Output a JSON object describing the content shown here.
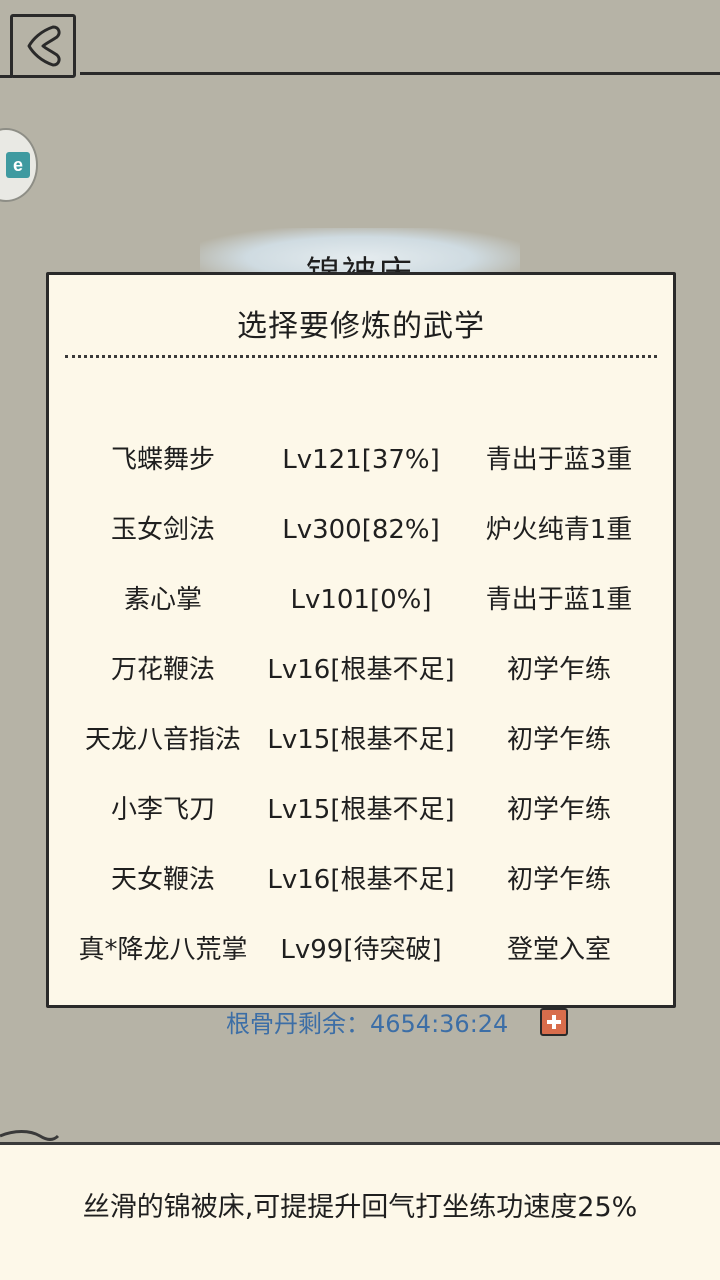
{
  "header": {
    "back_icon": "back-arrow-icon"
  },
  "side_button": {
    "glyph": "e",
    "icon": "app-badge-icon",
    "color": "#3f9aa0"
  },
  "background": {
    "item_title": "锦被床"
  },
  "dialog": {
    "title": "选择要修炼的武学",
    "skills": [
      {
        "name": "飞蝶舞步",
        "level": "Lv121[37%]",
        "rank": "青出于蓝3重"
      },
      {
        "name": "玉女剑法",
        "level": "Lv300[82%]",
        "rank": "炉火纯青1重"
      },
      {
        "name": "素心掌",
        "level": "Lv101[0%]",
        "rank": "青出于蓝1重"
      },
      {
        "name": "万花鞭法",
        "level": "Lv16[根基不足]",
        "rank": "初学乍练"
      },
      {
        "name": "天龙八音指法",
        "level": "Lv15[根基不足]",
        "rank": "初学乍练"
      },
      {
        "name": "小李飞刀",
        "level": "Lv15[根基不足]",
        "rank": "初学乍练"
      },
      {
        "name": "天女鞭法",
        "level": "Lv16[根基不足]",
        "rank": "初学乍练"
      },
      {
        "name": "真*降龙八荒掌",
        "level": "Lv99[待突破]",
        "rank": "登堂入室"
      }
    ]
  },
  "pill": {
    "remaining_text": "根骨丹剩余：4654:36:24",
    "add_icon": "plus-icon",
    "text_color": "#3c6ea6"
  },
  "footer": {
    "description": "丝滑的锦被床,可提提升回气打坐练功速度25%"
  }
}
